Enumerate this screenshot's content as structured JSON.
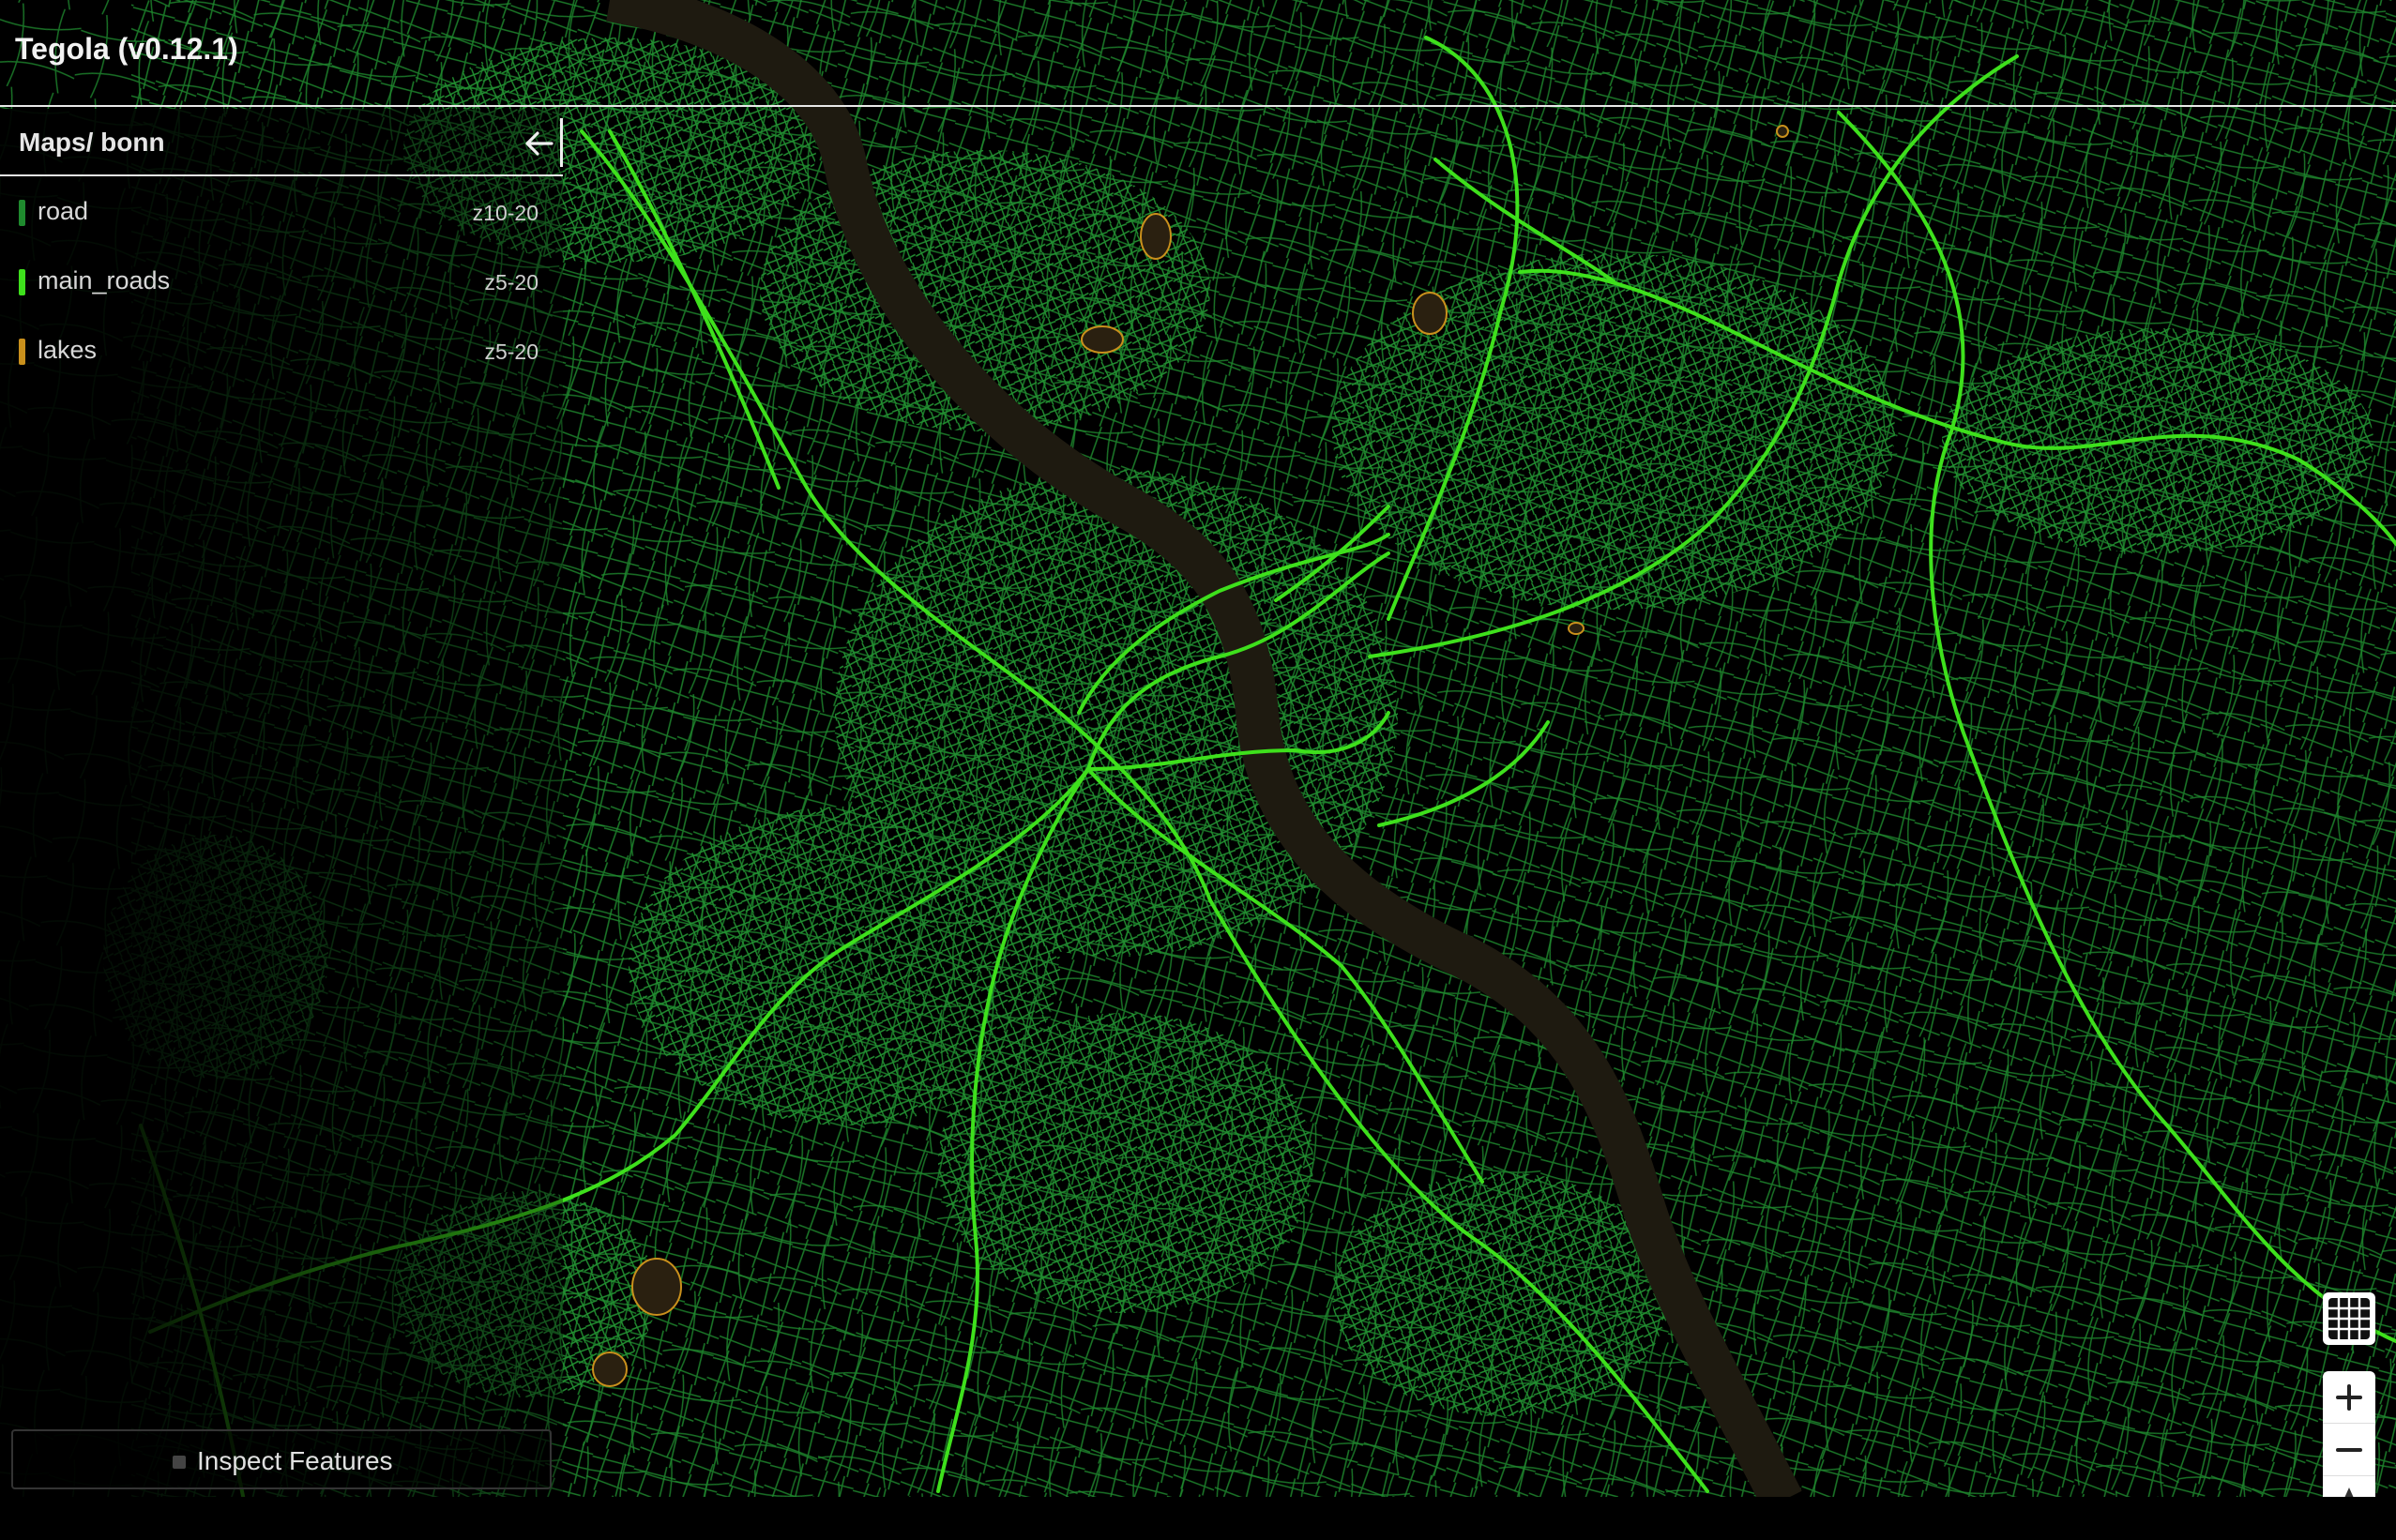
{
  "app": {
    "title": "Tegola (v0.12.1)"
  },
  "sidebar": {
    "map_title": "Maps/ bonn",
    "layers": [
      {
        "name": "road",
        "zoom": "z10-20",
        "color": "#1f8a2e"
      },
      {
        "name": "main_roads",
        "zoom": "z5-20",
        "color": "#3ee01c"
      },
      {
        "name": "lakes",
        "zoom": "z5-20",
        "color": "#c9901c"
      }
    ],
    "inspect_label": "Inspect Features"
  },
  "map": {
    "style": {
      "background": "#000000",
      "road": "#1f8a2e",
      "main_roads": "#3ee01c",
      "lakes": "#c9901c",
      "river": "#1e1a10"
    }
  },
  "controls": {
    "grid_icon": "tile-grid-icon",
    "zoom_in_icon": "plus-icon",
    "zoom_out_icon": "minus-icon",
    "compass_icon": "compass-icon"
  }
}
